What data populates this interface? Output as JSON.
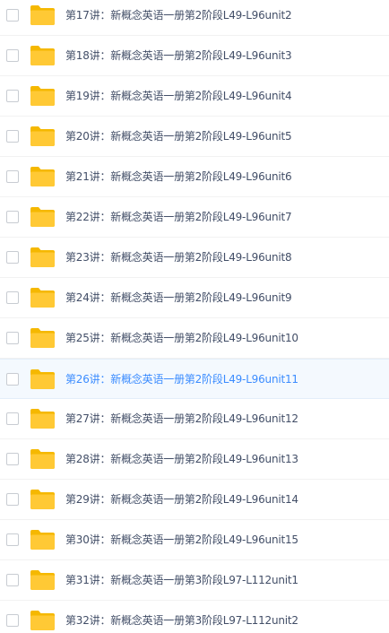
{
  "colors": {
    "folder": "#ffc935",
    "folder_back": "#f5b800",
    "text": "#424e67",
    "highlight_text": "#3b8cff",
    "highlight_bg": "#f4f9fe"
  },
  "files": [
    {
      "name": "第17讲：新概念英语一册第2阶段L49-L96unit2",
      "highlighted": false
    },
    {
      "name": "第18讲：新概念英语一册第2阶段L49-L96unit3",
      "highlighted": false
    },
    {
      "name": "第19讲：新概念英语一册第2阶段L49-L96unit4",
      "highlighted": false
    },
    {
      "name": "第20讲：新概念英语一册第2阶段L49-L96unit5",
      "highlighted": false
    },
    {
      "name": "第21讲：新概念英语一册第2阶段L49-L96unit6",
      "highlighted": false
    },
    {
      "name": "第22讲：新概念英语一册第2阶段L49-L96unit7",
      "highlighted": false
    },
    {
      "name": "第23讲：新概念英语一册第2阶段L49-L96unit8",
      "highlighted": false
    },
    {
      "name": "第24讲：新概念英语一册第2阶段L49-L96unit9",
      "highlighted": false
    },
    {
      "name": "第25讲：新概念英语一册第2阶段L49-L96unit10",
      "highlighted": false
    },
    {
      "name": "第26讲：新概念英语一册第2阶段L49-L96unit11",
      "highlighted": true
    },
    {
      "name": "第27讲：新概念英语一册第2阶段L49-L96unit12",
      "highlighted": false
    },
    {
      "name": "第28讲：新概念英语一册第2阶段L49-L96unit13",
      "highlighted": false
    },
    {
      "name": "第29讲：新概念英语一册第2阶段L49-L96unit14",
      "highlighted": false
    },
    {
      "name": "第30讲：新概念英语一册第2阶段L49-L96unit15",
      "highlighted": false
    },
    {
      "name": "第31讲：新概念英语一册第3阶段L97-L112unit1",
      "highlighted": false
    },
    {
      "name": "第32讲：新概念英语一册第3阶段L97-L112unit2",
      "highlighted": false
    }
  ]
}
